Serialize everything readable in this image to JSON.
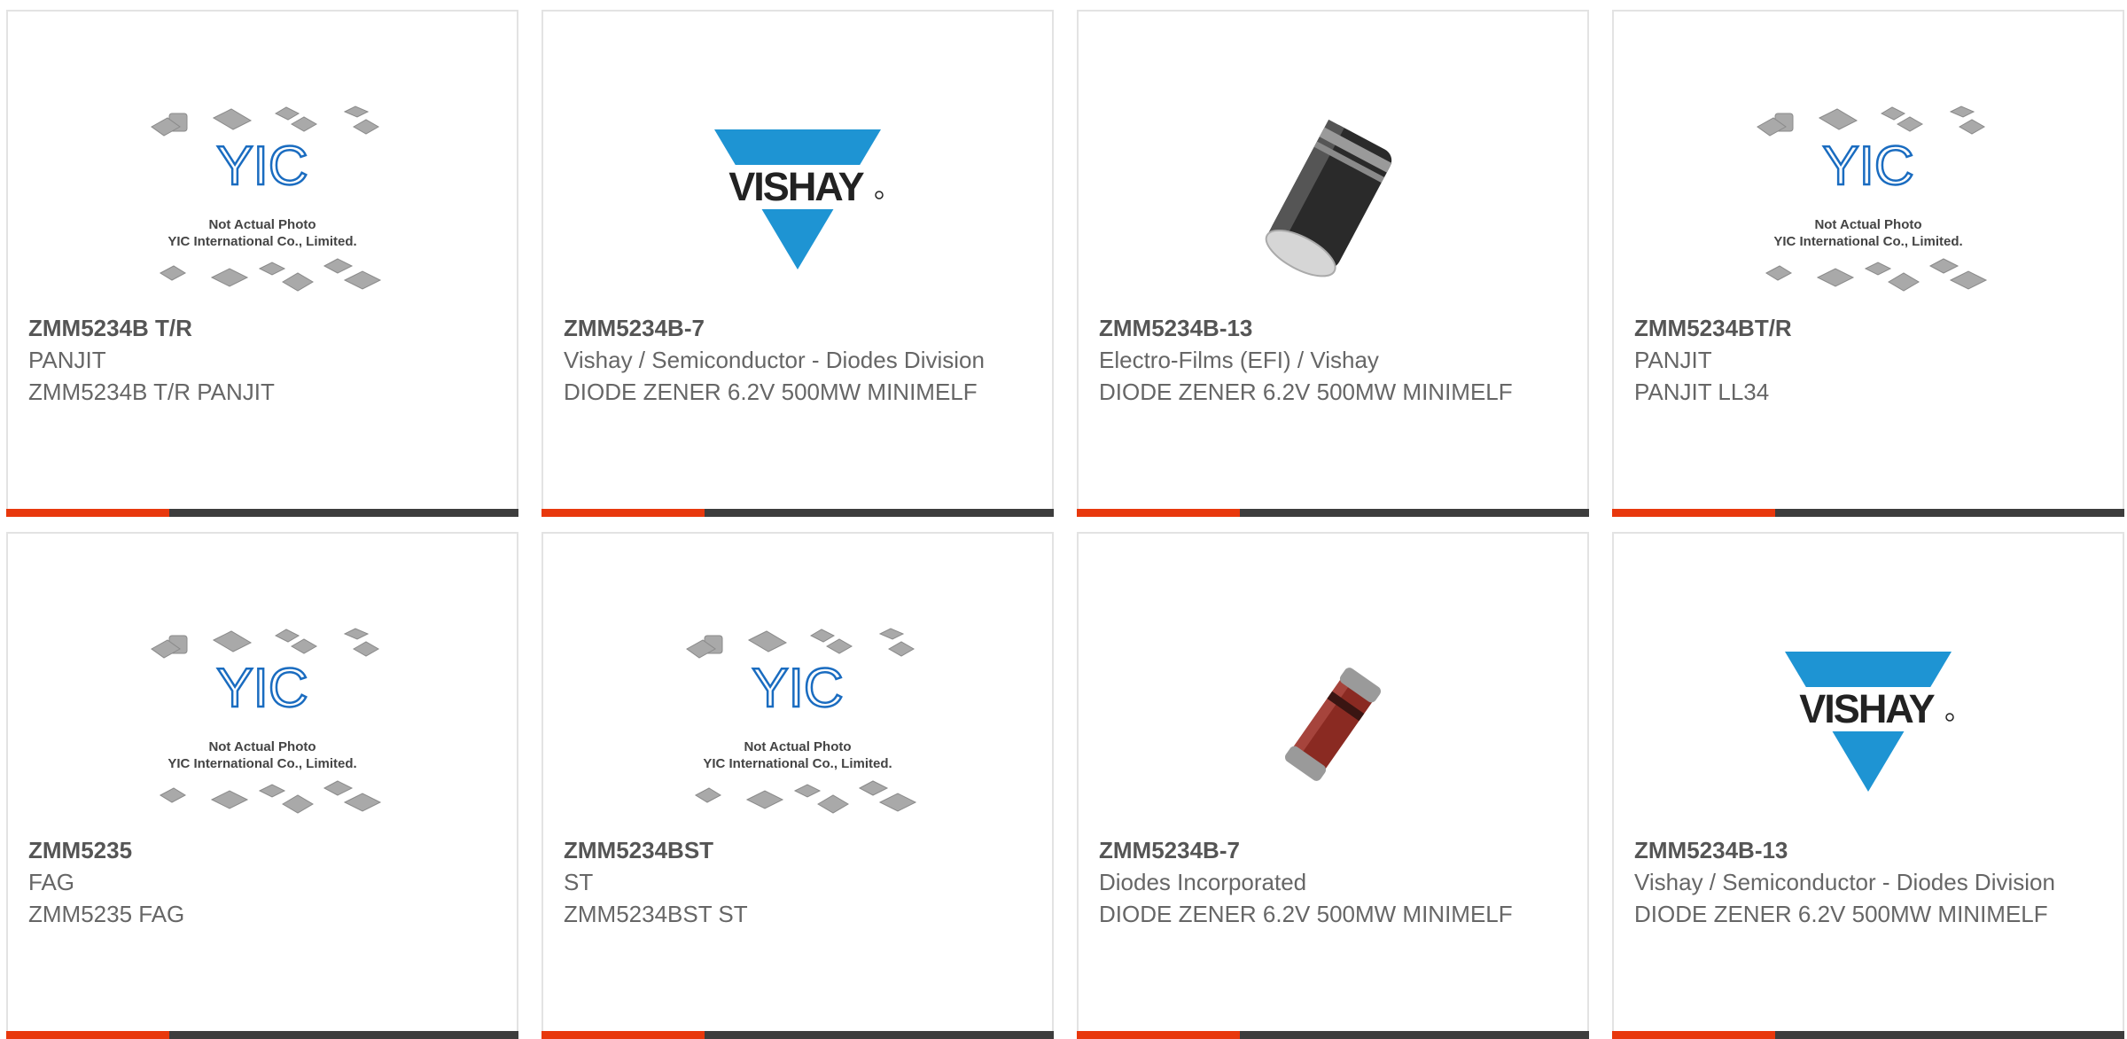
{
  "theme": {
    "accent": "#e8380d",
    "bar": "#3d3d3d"
  },
  "placeholder_text": {
    "line1": "Not Actual Photo",
    "line2": "YIC International Co., Limited.",
    "logo": "YIC"
  },
  "vishay_logo_text": "VISHAY",
  "products": [
    {
      "part": "ZMM5234B T/R",
      "manufacturer": "PANJIT",
      "description": "ZMM5234B T/R PANJIT",
      "image": "placeholder-image"
    },
    {
      "part": "ZMM5234B-7",
      "manufacturer": "Vishay / Semiconductor - Diodes Division",
      "description": "DIODE ZENER 6.2V 500MW MINIMELF",
      "image": "vishay-logo"
    },
    {
      "part": "ZMM5234B-13",
      "manufacturer": "Electro-Films (EFI) / Vishay",
      "description": "DIODE ZENER 6.2V 500MW MINIMELF",
      "image": "black-diode-photo"
    },
    {
      "part": "ZMM5234BT/R",
      "manufacturer": "PANJIT",
      "description": "PANJIT LL34",
      "image": "placeholder-image"
    },
    {
      "part": "ZMM5235",
      "manufacturer": "FAG",
      "description": "ZMM5235 FAG",
      "image": "placeholder-image"
    },
    {
      "part": "ZMM5234BST",
      "manufacturer": "ST",
      "description": "ZMM5234BST ST",
      "image": "placeholder-image"
    },
    {
      "part": "ZMM5234B-7",
      "manufacturer": "Diodes Incorporated",
      "description": "DIODE ZENER 6.2V 500MW MINIMELF",
      "image": "red-diode-photo"
    },
    {
      "part": "ZMM5234B-13",
      "manufacturer": "Vishay / Semiconductor - Diodes Division",
      "description": "DIODE ZENER 6.2V 500MW MINIMELF",
      "image": "vishay-logo"
    }
  ]
}
